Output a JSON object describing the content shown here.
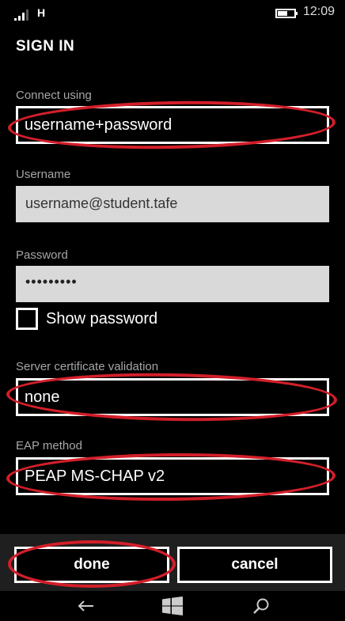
{
  "status_bar": {
    "network": "H",
    "time": "12:09"
  },
  "page": {
    "title": "SIGN IN"
  },
  "form": {
    "connect_using": {
      "label": "Connect using",
      "value": "username+password"
    },
    "username": {
      "label": "Username",
      "value": "username@student.tafe"
    },
    "password": {
      "label": "Password",
      "value": "•••••••••"
    },
    "show_password": {
      "label": "Show password",
      "checked": false
    },
    "server_cert": {
      "label": "Server certificate validation",
      "value": "none"
    },
    "eap_method": {
      "label": "EAP method",
      "value": "PEAP MS-CHAP v2"
    }
  },
  "app_bar": {
    "done_label": "done",
    "cancel_label": "cancel"
  },
  "icons": [
    "signal-icon",
    "battery-icon",
    "back-icon",
    "windows-icon",
    "search-icon"
  ],
  "colors": {
    "background": "#000000",
    "annotation": "#d21f2a",
    "input_fill": "#d9d9d9",
    "app_bar": "#1f1f1f"
  }
}
